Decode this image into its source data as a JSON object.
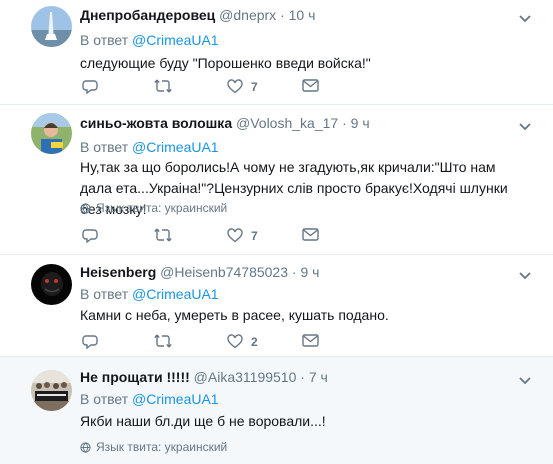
{
  "reply_prefix": "В ответ",
  "lang_label": "Язык твита: украинский",
  "icons": {
    "reply": "reply-icon",
    "retweet": "retweet-icon",
    "like": "heart-icon",
    "menu": "chevron-down-icon",
    "globe": "globe-icon"
  },
  "colors": {
    "link": "#1b95e0",
    "muted": "#657786",
    "shaded_bg": "#f5f8fa"
  },
  "tweets": [
    {
      "name": "Днепробандеровец",
      "handle": "@dneprx",
      "time": "10 ч",
      "reply_to": "@CrimeaUA1",
      "text": "следующие буду \"Порошенко введи войска!\"",
      "likes": "7"
    },
    {
      "name": "синьо-жовта волошка",
      "handle": "@Volosh_ka_17",
      "time": "9 ч",
      "reply_to": "@CrimeaUA1",
      "text": "Ну,так за що боролись!А чому не згадують,як кричали:\"Што нам дала ета...Украіна!\"?Цензурних слів просто бракує!Ходячі шлунки без мозку!",
      "likes": "7"
    },
    {
      "name": "Heisenberg",
      "handle": "@Heisenb74785023",
      "time": "9 ч",
      "reply_to": "@CrimeaUA1",
      "text": "Камни с неба, умереть в расее, кушать подано.",
      "likes": "2"
    },
    {
      "name": "Не прощати !!!!!",
      "handle": "@Aika31199510",
      "time": "7 ч",
      "reply_to": "@CrimeaUA1",
      "text": "Якби наши бл.ди ще б не воровали...!",
      "likes": ""
    }
  ]
}
